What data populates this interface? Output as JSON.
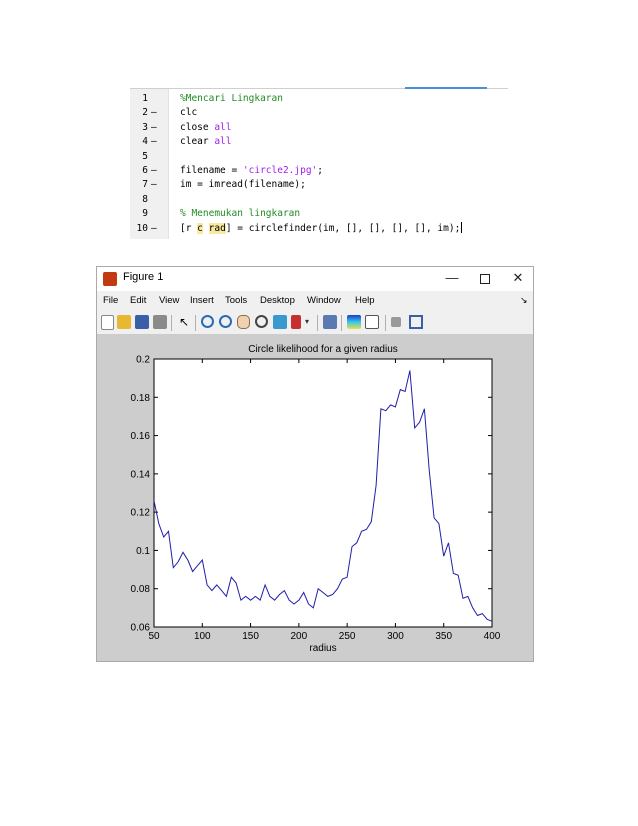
{
  "editor": {
    "lines": [
      {
        "num": "1",
        "dash": "",
        "parts": [
          {
            "t": "%Mencari Lingkaran",
            "c": "c-comment"
          }
        ]
      },
      {
        "num": "2",
        "dash": "–",
        "parts": [
          {
            "t": "clc",
            "c": "c-plain"
          }
        ]
      },
      {
        "num": "3",
        "dash": "–",
        "parts": [
          {
            "t": "close ",
            "c": "c-plain"
          },
          {
            "t": "all",
            "c": "c-string"
          }
        ]
      },
      {
        "num": "4",
        "dash": "–",
        "parts": [
          {
            "t": "clear ",
            "c": "c-plain"
          },
          {
            "t": "all",
            "c": "c-string"
          }
        ]
      },
      {
        "num": "5",
        "dash": "",
        "parts": []
      },
      {
        "num": "6",
        "dash": "–",
        "parts": [
          {
            "t": "filename = ",
            "c": "c-plain"
          },
          {
            "t": "'circle2.jpg'",
            "c": "c-string"
          },
          {
            "t": ";",
            "c": "c-plain"
          }
        ]
      },
      {
        "num": "7",
        "dash": "–",
        "parts": [
          {
            "t": "im = imread(filename);",
            "c": "c-plain"
          }
        ]
      },
      {
        "num": "8",
        "dash": "",
        "parts": []
      },
      {
        "num": "9",
        "dash": "",
        "parts": [
          {
            "t": "% Menemukan lingkaran",
            "c": "c-comment"
          }
        ]
      },
      {
        "num": "10",
        "dash": "–",
        "parts": [
          {
            "t": "[r ",
            "c": "c-plain"
          },
          {
            "t": "c",
            "c": "c-plain hl"
          },
          {
            "t": " ",
            "c": "c-plain"
          },
          {
            "t": "rad",
            "c": "c-plain hl"
          },
          {
            "t": "] = circlefinder(im, [], [], [], [], im);",
            "c": "c-plain"
          }
        ],
        "cursor": true
      }
    ]
  },
  "window": {
    "title": "Figure 1",
    "minimize": "—",
    "close": "✕"
  },
  "menu": [
    "File",
    "Edit",
    "View",
    "Insert",
    "Tools",
    "Desktop",
    "Window",
    "Help"
  ],
  "menu_overflow": "↘",
  "toolbar": [
    "new-file-icon",
    "open-folder-icon",
    "save-icon",
    "print-icon",
    "pointer-icon",
    "zoom-in-icon",
    "zoom-out-icon",
    "pan-icon",
    "rotate-3d-icon",
    "data-cursor-icon",
    "brush-icon",
    "link-plot-icon",
    "colorbar-icon",
    "legend-icon",
    "hide-plot-tools-icon",
    "show-plot-tools-icon"
  ],
  "colors": {
    "line": "#1f1fa8",
    "comment": "#228b22",
    "string": "#a020f0",
    "figure_bg": "#cdcdcd"
  },
  "chart_data": {
    "type": "line",
    "title": "Circle likelihood for a given radius",
    "xlabel": "radius",
    "ylabel": "",
    "xlim": [
      50,
      400
    ],
    "ylim": [
      0.06,
      0.2
    ],
    "xticks": [
      50,
      100,
      150,
      200,
      250,
      300,
      350,
      400
    ],
    "yticks": [
      0.06,
      0.08,
      0.1,
      0.12,
      0.14,
      0.16,
      0.18,
      0.2
    ],
    "ytick_labels": [
      "0.06",
      "0.08",
      "0.1",
      "0.12",
      "0.14",
      "0.16",
      "0.18",
      "0.2"
    ],
    "grid": false,
    "series": [
      {
        "x": [
          50,
          55,
          60,
          65,
          70,
          75,
          80,
          85,
          90,
          95,
          100,
          105,
          110,
          115,
          120,
          125,
          130,
          135,
          140,
          145,
          150,
          155,
          160,
          165,
          170,
          175,
          180,
          185,
          190,
          195,
          200,
          205,
          210,
          215,
          220,
          225,
          230,
          235,
          240,
          245,
          250,
          255,
          260,
          265,
          270,
          275,
          280,
          285,
          290,
          295,
          300,
          305,
          310,
          315,
          320,
          325,
          330,
          335,
          340,
          345,
          350,
          355,
          360,
          365,
          370,
          375,
          380,
          385,
          390,
          395,
          400
        ],
        "y": [
          0.126,
          0.114,
          0.107,
          0.11,
          0.091,
          0.094,
          0.099,
          0.095,
          0.089,
          0.092,
          0.095,
          0.082,
          0.079,
          0.082,
          0.079,
          0.076,
          0.086,
          0.083,
          0.074,
          0.076,
          0.074,
          0.076,
          0.074,
          0.082,
          0.076,
          0.074,
          0.077,
          0.079,
          0.074,
          0.072,
          0.074,
          0.078,
          0.072,
          0.07,
          0.08,
          0.078,
          0.076,
          0.077,
          0.08,
          0.085,
          0.086,
          0.102,
          0.104,
          0.11,
          0.111,
          0.115,
          0.134,
          0.174,
          0.173,
          0.176,
          0.175,
          0.184,
          0.183,
          0.194,
          0.164,
          0.167,
          0.174,
          0.142,
          0.117,
          0.114,
          0.097,
          0.104,
          0.088,
          0.087,
          0.075,
          0.076,
          0.07,
          0.066,
          0.067,
          0.064,
          0.063
        ]
      }
    ]
  }
}
